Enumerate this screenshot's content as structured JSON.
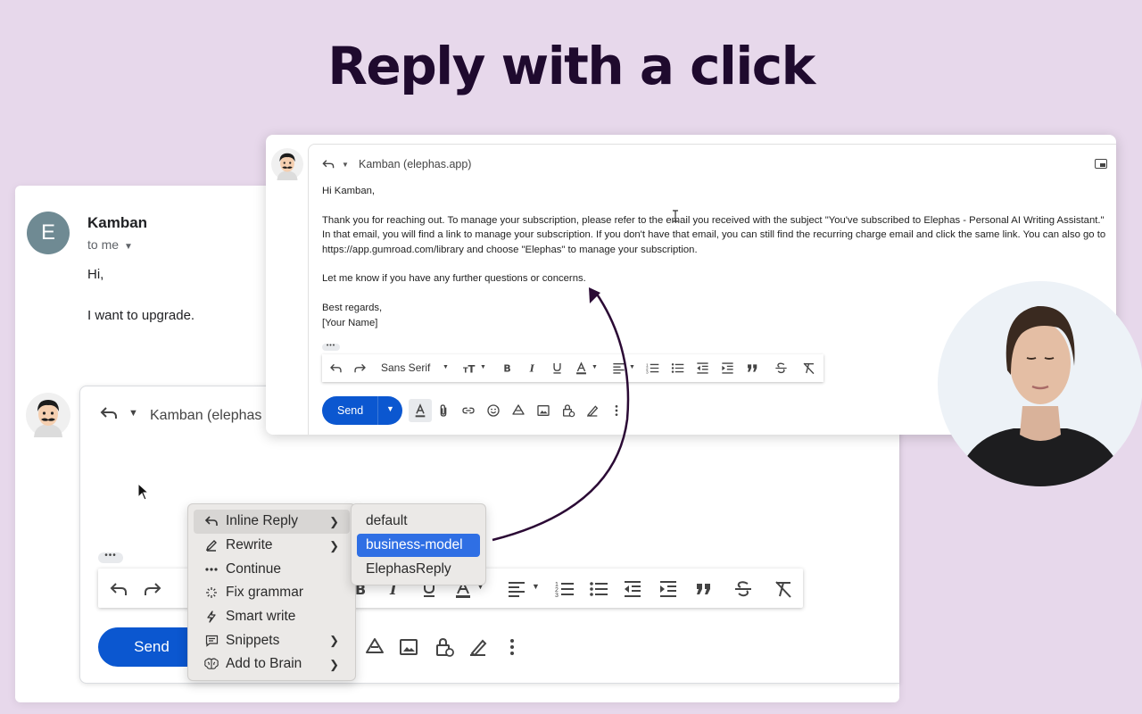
{
  "headline": "Reply with a click",
  "back_email": {
    "avatar_letter": "E",
    "sender": "Kamban",
    "recipient": "to me",
    "message_lines": [
      "Hi,",
      "I want to upgrade."
    ],
    "reply_to": "Kamban (elephas",
    "send_label": "Send"
  },
  "context_menu": {
    "items": [
      {
        "label": "Inline Reply",
        "icon": "reply-icon",
        "has_submenu": true
      },
      {
        "label": "Rewrite",
        "icon": "pencil-icon",
        "has_submenu": true
      },
      {
        "label": "Continue",
        "icon": "dots-icon",
        "has_submenu": false
      },
      {
        "label": "Fix grammar",
        "icon": "sparkle-icon",
        "has_submenu": false
      },
      {
        "label": "Smart write",
        "icon": "bolt-icon",
        "has_submenu": false
      },
      {
        "label": "Snippets",
        "icon": "speech-bubble-icon",
        "has_submenu": true
      },
      {
        "label": "Add to Brain",
        "icon": "brain-icon",
        "has_submenu": true
      }
    ],
    "submenu": [
      "default",
      "business-model",
      "ElephasReply"
    ],
    "selected_submenu": "business-model"
  },
  "front_email": {
    "reply_to": "Kamban (elephas.app)",
    "greeting": "Hi Kamban,",
    "paragraph1_line1": "Thank you for reaching out. To manage your subscription, please refer to the email you received with the subject \"You've subscribed to Elephas - Personal AI Writing Assistant.\"",
    "paragraph1_line2": "In that email, you will find a link to manage your subscription. If you don't have that email, you can still find the recurring charge email and click the same link. You can also go to",
    "paragraph1_line3": "https://app.gumroad.com/library and choose \"Elephas\" to manage your subscription.",
    "paragraph2": "Let me know if you have any further questions or concerns.",
    "closing": "Best regards,",
    "signature": "[Your Name]",
    "font_name": "Sans Serif",
    "send_label": "Send"
  },
  "colors": {
    "background": "#e7d8eb",
    "headline": "#1f0a2e",
    "send_button": "#0b57d0",
    "menu_selection": "#2f6fe4",
    "arrow": "#2b0a35"
  }
}
